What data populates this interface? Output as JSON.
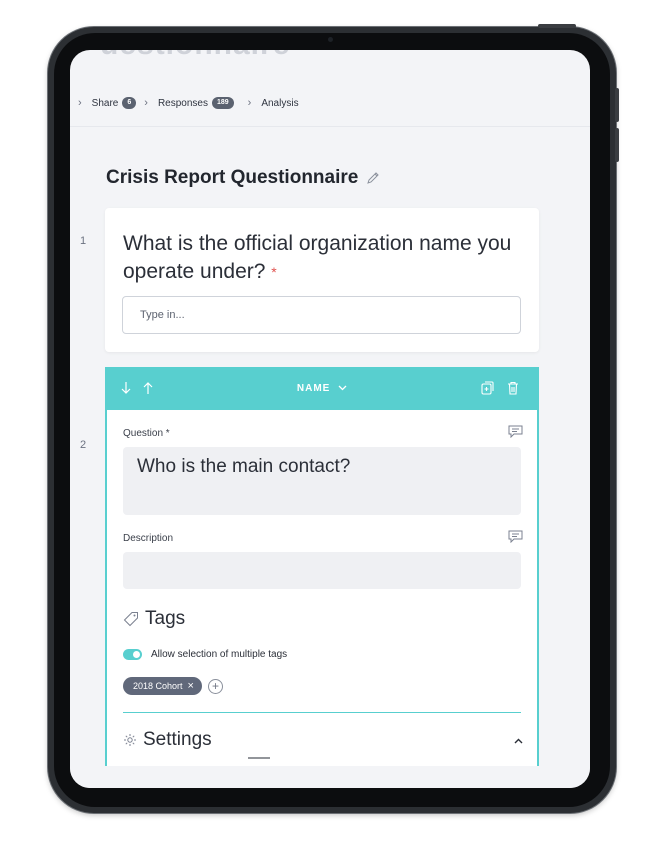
{
  "header": {
    "ghost_title": "uestionnaire",
    "breadcrumb": [
      {
        "label": "Share",
        "badge": "6"
      },
      {
        "label": "Responses",
        "badge": "189"
      },
      {
        "label": "Analysis",
        "badge": ""
      }
    ]
  },
  "page": {
    "title": "Crisis Report Questionnaire",
    "accent_color": "#58cfcf",
    "required_color": "#e0524f"
  },
  "questions": [
    {
      "number": "1",
      "text": "What is the official organization name you operate under?",
      "required_mark": "*",
      "input_placeholder": "Type in..."
    },
    {
      "number": "2",
      "type_label": "NAME",
      "question_label": "Question *",
      "question_value": "Who is the main contact?",
      "description_label": "Description",
      "description_value": "",
      "tags_heading": "Tags",
      "allow_multiple_label": "Allow selection of multiple tags",
      "allow_multiple": true,
      "tags": [
        "2018 Cohort"
      ],
      "settings_heading": "Settings"
    }
  ],
  "icons": {
    "move_down": "arrow-down-icon",
    "move_up": "arrow-up-icon",
    "duplicate": "duplicate-icon",
    "delete": "trash-icon",
    "comment": "comment-icon",
    "tag": "tag-icon",
    "settings": "gear-icon",
    "edit": "pencil-icon"
  }
}
